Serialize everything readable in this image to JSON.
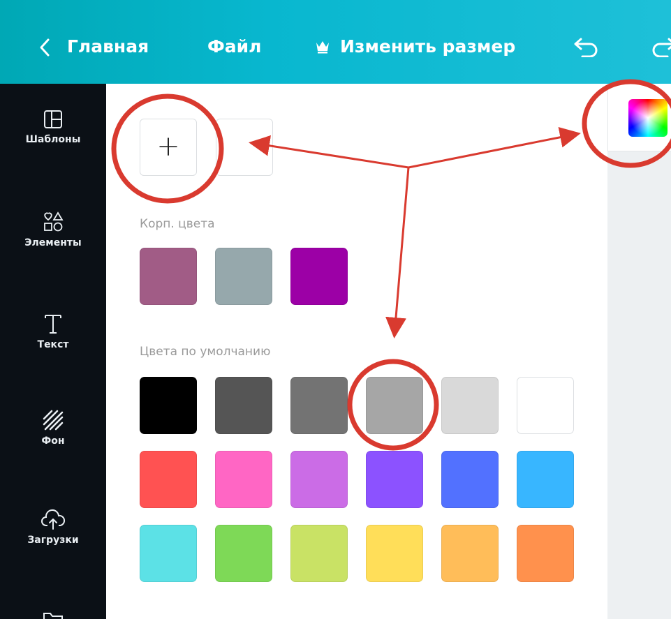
{
  "topbar": {
    "back_label": "Главная",
    "file_label": "Файл",
    "resize_label": "Изменить размер"
  },
  "sidebar": {
    "items": [
      {
        "label": "Шаблоны",
        "icon": "templates-icon"
      },
      {
        "label": "Элементы",
        "icon": "elements-icon"
      },
      {
        "label": "Текст",
        "icon": "text-icon"
      },
      {
        "label": "Фон",
        "icon": "background-icon"
      },
      {
        "label": "Загрузки",
        "icon": "uploads-icon"
      }
    ]
  },
  "panel": {
    "add_symbol": "+",
    "brand_label": "Корп. цвета",
    "default_label": "Цвета по умолчанию"
  },
  "brand_colors": [
    "#a15c86",
    "#96a8ac",
    "#9c00a6"
  ],
  "default_colors": [
    [
      "#000000",
      "#555555",
      "#737373",
      "#a6a6a6",
      "#d9d9d9",
      "#ffffff"
    ],
    [
      "#ff5252",
      "#ff66c4",
      "#cb6ce6",
      "#8c52ff",
      "#5271ff",
      "#38b6ff"
    ],
    [
      "#5ce1e6",
      "#7ed957",
      "#c9e265",
      "#ffde59",
      "#ffbd59",
      "#ff914d"
    ]
  ],
  "accent_red": "#d93a2f"
}
